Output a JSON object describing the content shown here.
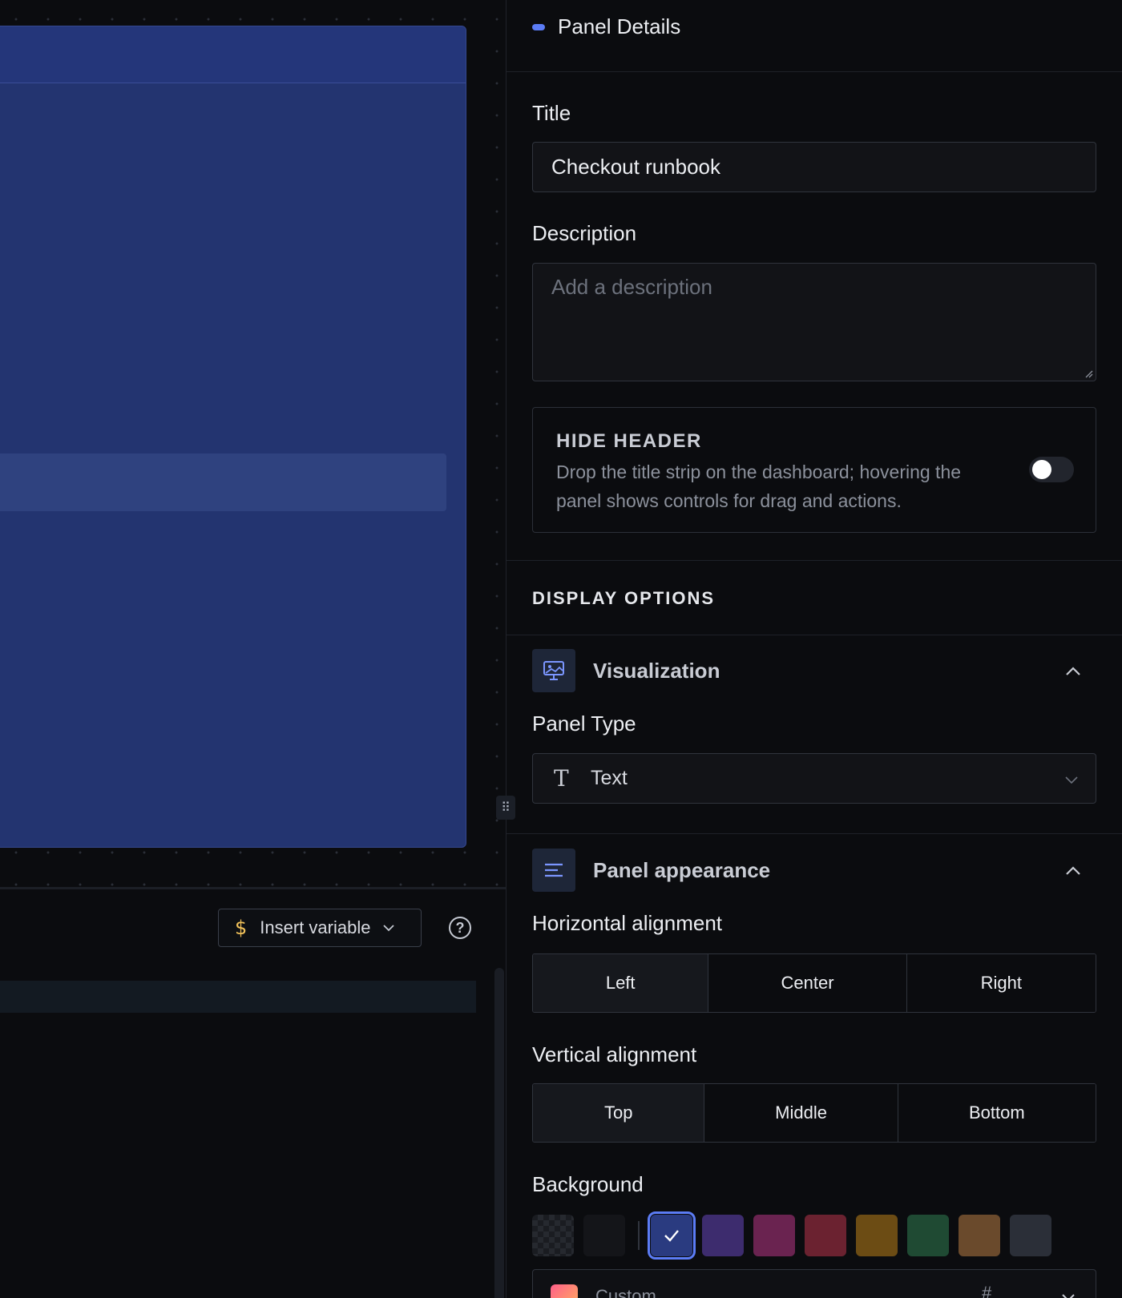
{
  "editor": {
    "insert_variable_label": "Insert variable",
    "dollar_glyph": "$",
    "help_glyph": "?",
    "resize_glyph": "⠿"
  },
  "details": {
    "header": "Panel Details",
    "title_label": "Title",
    "title_value": "Checkout runbook",
    "description_label": "Description",
    "description_placeholder": "Add a description",
    "hide_header": {
      "title": "HIDE HEADER",
      "description": "Drop the title strip on the dashboard; hovering the panel shows controls for drag and actions.",
      "enabled": false
    }
  },
  "display_options": {
    "heading": "DISPLAY OPTIONS",
    "visualization": {
      "title": "Visualization",
      "icon": "monitor-image-icon",
      "panel_type_label": "Panel Type",
      "panel_type_value": "Text",
      "panel_type_icon_glyph": "T"
    },
    "appearance": {
      "title": "Panel appearance",
      "icon": "align-left-icon",
      "horizontal_label": "Horizontal alignment",
      "horizontal_options": [
        "Left",
        "Center",
        "Right"
      ],
      "horizontal_selected": "Left",
      "vertical_label": "Vertical alignment",
      "vertical_options": [
        "Top",
        "Middle",
        "Bottom"
      ],
      "vertical_selected": "Top",
      "background_label": "Background",
      "background_swatches": [
        "transparent",
        "#141519",
        "#2a3b80",
        "#3d2c6e",
        "#6a2350",
        "#6b2230",
        "#6c4c14",
        "#1f4a33",
        "#6a4a2c",
        "#2b2f38"
      ],
      "background_selected_index": 2,
      "custom_label": "Custom",
      "custom_hash": "#"
    }
  },
  "colors": {
    "accent": "#5b7cf5",
    "panel_blue": "#233470",
    "dollar": "#f2c25a"
  }
}
